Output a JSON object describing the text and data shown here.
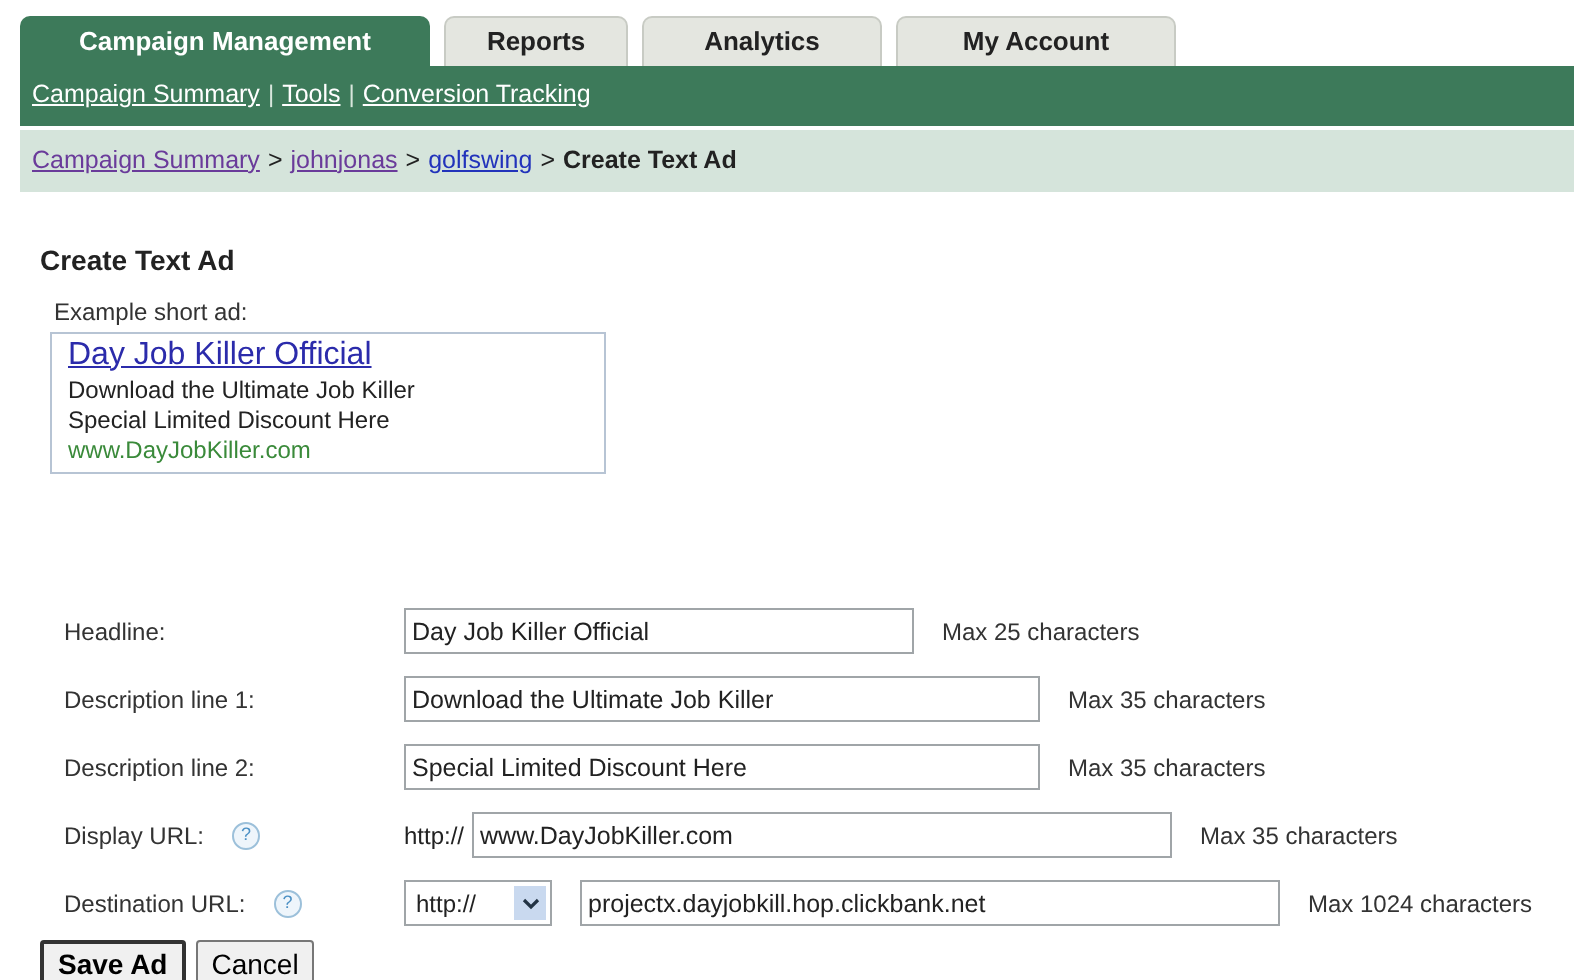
{
  "tabs": [
    {
      "label": "Campaign Management",
      "selected": true
    },
    {
      "label": "Reports",
      "selected": false
    },
    {
      "label": "Analytics",
      "selected": false
    },
    {
      "label": "My Account",
      "selected": false
    }
  ],
  "subnav": [
    {
      "label": "Campaign Summary"
    },
    {
      "label": "Tools"
    },
    {
      "label": "Conversion Tracking"
    }
  ],
  "subnav_separator": "|",
  "breadcrumb": [
    {
      "label": "Campaign Summary",
      "kind": "link",
      "visited": true
    },
    {
      "label": "johnjonas",
      "kind": "link",
      "visited": true
    },
    {
      "label": "golfswing",
      "kind": "link",
      "visited": false
    },
    {
      "label": "Create Text Ad",
      "kind": "current"
    }
  ],
  "breadcrumb_separator": ">",
  "page_title": "Create Text Ad",
  "example": {
    "label": "Example short ad:",
    "headline": "Day Job Killer Official",
    "lines": [
      "Download the Ultimate Job Killer",
      "Special Limited Discount Here"
    ],
    "url": "www.DayJobKiller.com"
  },
  "fields": [
    {
      "kind": "text",
      "label": "Headline:",
      "help": false,
      "value": "Day Job Killer Official",
      "note": "Max 25 characters"
    },
    {
      "kind": "text",
      "label": "Description line 1:",
      "help": false,
      "value": "Download the Ultimate Job Killer",
      "note": "Max 35 characters"
    },
    {
      "kind": "text",
      "label": "Description line 2:",
      "help": false,
      "value": "Special Limited Discount Here",
      "note": "Max 35 characters"
    },
    {
      "kind": "prefix",
      "label": "Display URL:",
      "help": true,
      "prefix": "http://",
      "value": "www.DayJobKiller.com",
      "note": "Max 35 characters"
    },
    {
      "kind": "select",
      "label": "Destination URL:",
      "help": true,
      "prefix": "http://",
      "value": "projectx.dayjobkill.hop.clickbank.net",
      "note": "Max 1024 characters"
    }
  ],
  "help_glyph": "?",
  "buttons": [
    "Save Ad",
    "Cancel"
  ]
}
